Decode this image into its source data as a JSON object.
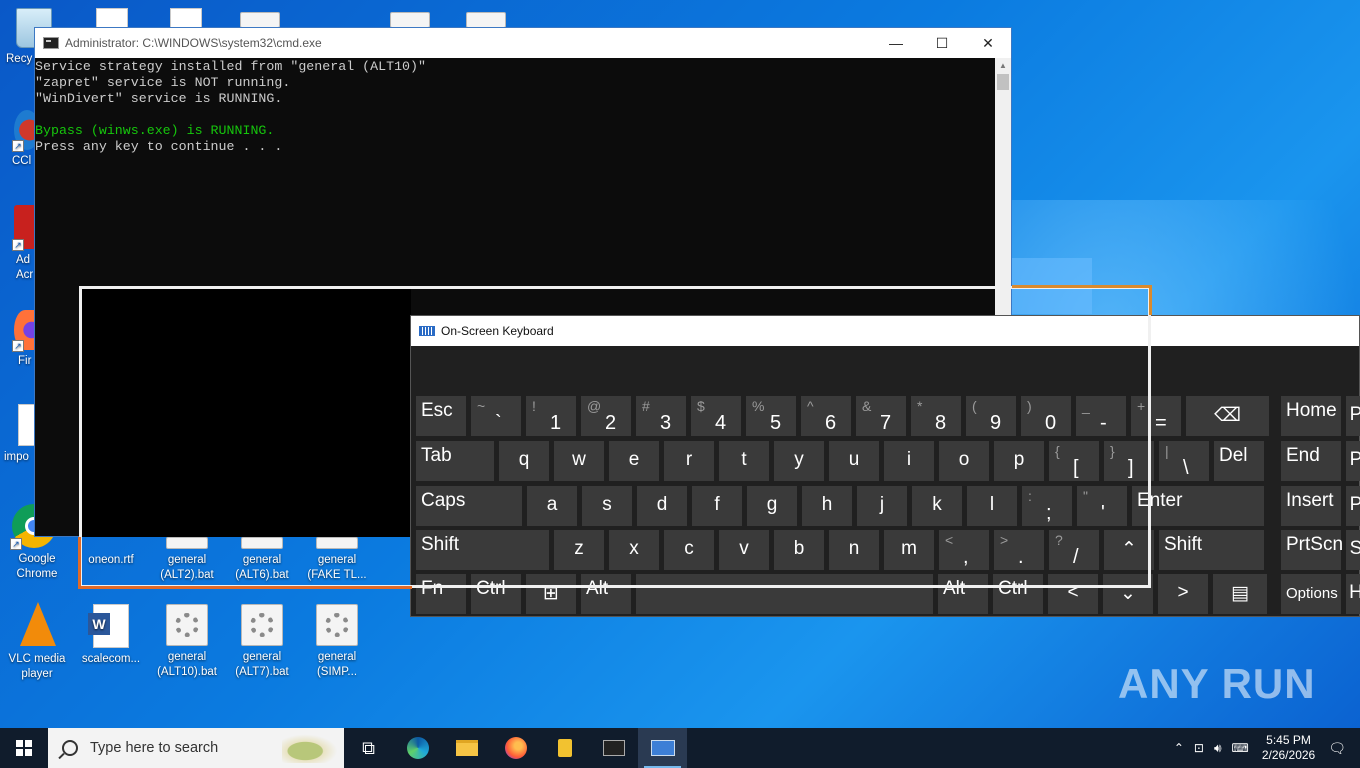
{
  "desktop": {
    "icons_left": [
      {
        "label": "Recy"
      },
      {
        "label": "CCl"
      },
      {
        "label": "Ad\nAcr"
      },
      {
        "label": "Fir"
      },
      {
        "label": "impo"
      },
      {
        "label": "Google\nChrome"
      },
      {
        "label": "VLC media\nplayer"
      }
    ],
    "icons_row1": [
      {
        "label": "oneon.rtf"
      },
      {
        "label": "general\n(ALT2).bat"
      },
      {
        "label": "general\n(ALT6).bat"
      },
      {
        "label": "general\n(FAKE TL..."
      }
    ],
    "icons_row2": [
      {
        "label": "scalecom..."
      },
      {
        "label": "general\n(ALT10).bat"
      },
      {
        "label": "general\n(ALT7).bat"
      },
      {
        "label": "general\n(SIMP..."
      }
    ],
    "watermark": "ANY RUN"
  },
  "cmd": {
    "title": "Administrator: C:\\WINDOWS\\system32\\cmd.exe",
    "lines": [
      "Service strategy installed from \"general (ALT10)\"",
      "\"zapret\" service is NOT running.",
      "\"WinDivert\" service is RUNNING.",
      "",
      "Bypass (winws.exe) is RUNNING.",
      "Press any key to continue . . ."
    ],
    "minimize_glyph": "—",
    "maximize_glyph": "☐",
    "close_glyph": "✕"
  },
  "osk": {
    "title": "On-Screen Keyboard",
    "rows": [
      [
        {
          "main": "Esc"
        },
        {
          "sub": "~",
          "low": "`"
        },
        {
          "sub": "!",
          "low": "1"
        },
        {
          "sub": "@",
          "low": "2"
        },
        {
          "sub": "#",
          "low": "3"
        },
        {
          "sub": "$",
          "low": "4"
        },
        {
          "sub": "%",
          "low": "5"
        },
        {
          "sub": "^",
          "low": "6"
        },
        {
          "sub": "&",
          "low": "7"
        },
        {
          "sub": "*",
          "low": "8"
        },
        {
          "sub": "(",
          "low": "9"
        },
        {
          "sub": ")",
          "low": "0"
        },
        {
          "sub": "_",
          "low": "-"
        },
        {
          "sub": "+",
          "low": "="
        },
        {
          "main": "⌫"
        },
        {
          "main": "Home"
        },
        {
          "main": "P"
        }
      ],
      [
        {
          "main": "Tab"
        },
        {
          "main": "q"
        },
        {
          "main": "w"
        },
        {
          "main": "e"
        },
        {
          "main": "r"
        },
        {
          "main": "t"
        },
        {
          "main": "y"
        },
        {
          "main": "u"
        },
        {
          "main": "i"
        },
        {
          "main": "o"
        },
        {
          "main": "p"
        },
        {
          "sub": "{",
          "low": "["
        },
        {
          "sub": "}",
          "low": "]"
        },
        {
          "sub": "|",
          "low": "\\"
        },
        {
          "main": "Del"
        },
        {
          "main": "End"
        },
        {
          "main": "P"
        }
      ],
      [
        {
          "main": "Caps"
        },
        {
          "main": "a"
        },
        {
          "main": "s"
        },
        {
          "main": "d"
        },
        {
          "main": "f"
        },
        {
          "main": "g"
        },
        {
          "main": "h"
        },
        {
          "main": "j"
        },
        {
          "main": "k"
        },
        {
          "main": "l"
        },
        {
          "sub": ":",
          "low": ";"
        },
        {
          "sub": "\"",
          "low": "'"
        },
        {
          "main": "Enter"
        },
        {
          "main": "Insert"
        },
        {
          "main": "P"
        }
      ],
      [
        {
          "main": "Shift"
        },
        {
          "main": "z"
        },
        {
          "main": "x"
        },
        {
          "main": "c"
        },
        {
          "main": "v"
        },
        {
          "main": "b"
        },
        {
          "main": "n"
        },
        {
          "main": "m"
        },
        {
          "sub": "<",
          "low": ","
        },
        {
          "sub": ">",
          "low": "."
        },
        {
          "sub": "?",
          "low": "/"
        },
        {
          "main": "⌃"
        },
        {
          "main": "Shift"
        },
        {
          "main": "PrtScn"
        },
        {
          "main": "S"
        }
      ],
      [
        {
          "main": "Fn"
        },
        {
          "main": "Ctrl"
        },
        {
          "main": "⊞"
        },
        {
          "main": "Alt"
        },
        {
          "main": ""
        },
        {
          "main": "Alt"
        },
        {
          "main": "Ctrl"
        },
        {
          "main": "<"
        },
        {
          "main": "⌄"
        },
        {
          "main": ">"
        },
        {
          "main": "▤"
        },
        {
          "main": "Options"
        },
        {
          "main": "H"
        }
      ]
    ]
  },
  "taskbar": {
    "search_placeholder": "Type here to search",
    "time": "5:45 PM",
    "date": "2/26/2026",
    "tray_chevron": "⌃",
    "notification_glyph": "🗨"
  }
}
